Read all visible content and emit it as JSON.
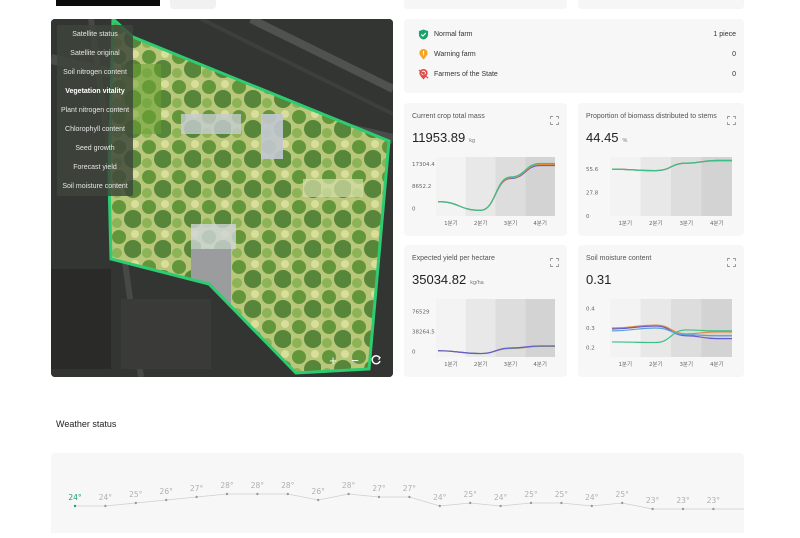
{
  "map": {
    "layers": [
      "Satellite status",
      "Satellite original",
      "Soil nitrogen content",
      "Vegetation vitality",
      "Plant nitrogen content",
      "Chlorophyll content",
      "Seed growth",
      "Forecast yield",
      "Soil moisture content"
    ],
    "active_layer": "Vegetation vitality",
    "controls": {
      "zoom_in": "+",
      "zoom_out": "−",
      "refresh": "↻"
    }
  },
  "status": {
    "rows": [
      {
        "label": "Normal farm",
        "count": "1 piece",
        "icon": "shield-check-icon",
        "color": "#1aa36b"
      },
      {
        "label": "Warning farm",
        "count": "0",
        "icon": "warning-pin-icon",
        "color": "#f5a623"
      },
      {
        "label": "Farmers of the State",
        "count": "0",
        "icon": "prohibited-pin-icon",
        "color": "#e24a4a"
      }
    ]
  },
  "charts": {
    "crop_mass": {
      "title": "Current crop total mass",
      "value": "11953.89",
      "unit": "kg",
      "chart_data": {
        "type": "line",
        "categories": [
          "1분기",
          "2분기",
          "3분기",
          "4분기"
        ],
        "yticks": [
          "17304.4",
          "8652.2",
          "0"
        ],
        "ylim": [
          -3000,
          20000
        ],
        "series": [
          {
            "color": "#6a5acd",
            "values": [
              2600,
              -800,
              11600,
              16700
            ]
          },
          {
            "color": "#e08c3a",
            "values": [
              2600,
              -800,
              11900,
              17100
            ]
          },
          {
            "color": "#3bbf87",
            "values": [
              2600,
              -800,
              12200,
              17500
            ]
          }
        ]
      }
    },
    "biomass_stems": {
      "title": "Proportion of biomass distributed to stems",
      "value": "44.45",
      "unit": "%",
      "chart_data": {
        "type": "line",
        "categories": [
          "1분기",
          "2분기",
          "3분기",
          "4분기"
        ],
        "yticks": [
          "55.6",
          "27.8",
          "0"
        ],
        "ylim": [
          0,
          70
        ],
        "series": [
          {
            "color": "#6a5acd",
            "values": [
              55.6,
              53.8,
              62.6,
              65.7
            ]
          },
          {
            "color": "#e08c3a",
            "values": [
              55.6,
              53.8,
              62.7,
              65.9
            ]
          },
          {
            "color": "#3bbf87",
            "values": [
              55.6,
              53.8,
              62.8,
              66.0
            ]
          }
        ]
      }
    },
    "yield_hectare": {
      "title": "Expected yield per hectare",
      "value": "35034.82",
      "unit": "kg/ha",
      "chart_data": {
        "type": "line",
        "categories": [
          "1분기",
          "2분기",
          "3분기",
          "4분기"
        ],
        "yticks": [
          "76529",
          "38264.5",
          "0"
        ],
        "ylim": [
          -10000,
          100000
        ],
        "series": [
          {
            "color": "#e08c3a",
            "values": [
              2000,
              -3500,
              6000,
              10000
            ]
          },
          {
            "color": "#3bbf87",
            "values": [
              2000,
              -3500,
              6500,
              10500
            ]
          },
          {
            "color": "#6a5acd",
            "values": [
              2000,
              -3500,
              7000,
              11000
            ]
          }
        ]
      }
    },
    "soil_moisture": {
      "title": "Soil moisture content",
      "value": "0.31",
      "unit": "",
      "chart_data": {
        "type": "line",
        "categories": [
          "1분기",
          "2분기",
          "3분기",
          "4분기"
        ],
        "yticks": [
          "0.4",
          "0.3",
          "0.2"
        ],
        "ylim": [
          0.15,
          0.45
        ],
        "series": [
          {
            "color": "#e08c3a",
            "values": [
              0.3,
              0.315,
              0.27,
              0.28
            ]
          },
          {
            "color": "#6a5acd",
            "values": [
              0.295,
              0.31,
              0.26,
              0.245
            ]
          },
          {
            "color": "#5aa0d8",
            "values": [
              0.285,
              0.3,
              0.265,
              0.26
            ]
          },
          {
            "color": "#3bbf87",
            "values": [
              0.228,
              0.225,
              0.29,
              0.285
            ]
          }
        ]
      }
    }
  },
  "weather": {
    "title": "Weather status",
    "chart_data": {
      "type": "line",
      "values": [
        24,
        24,
        25,
        26,
        27,
        28,
        28,
        28,
        26,
        28,
        27,
        27,
        24,
        25,
        24,
        25,
        25,
        24,
        25,
        23,
        23,
        23
      ],
      "unit": "°"
    }
  }
}
